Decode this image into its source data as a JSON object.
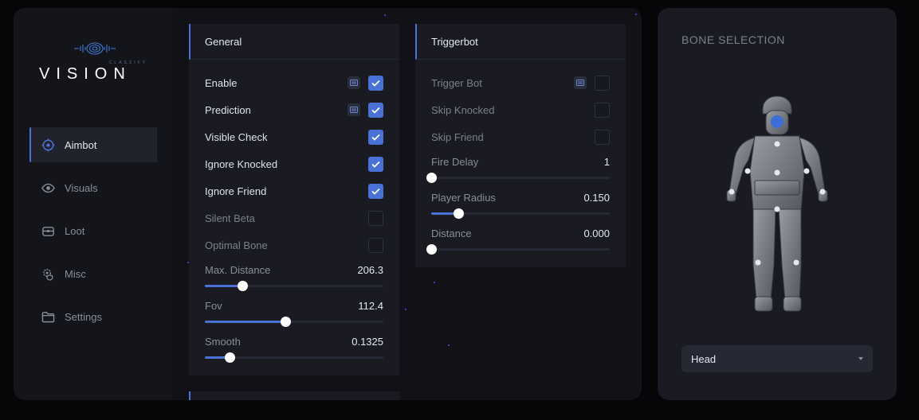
{
  "logo": {
    "tagline": "CLASSIFY",
    "word": "VISION"
  },
  "nav": [
    {
      "label": "Aimbot",
      "icon": "target-icon",
      "active": true
    },
    {
      "label": "Visuals",
      "icon": "eye-icon",
      "active": false
    },
    {
      "label": "Loot",
      "icon": "chest-icon",
      "active": false
    },
    {
      "label": "Misc",
      "icon": "gear-shield-icon",
      "active": false
    },
    {
      "label": "Settings",
      "icon": "folder-icon",
      "active": false
    }
  ],
  "general": {
    "title": "General",
    "toggles": [
      {
        "label": "Enable",
        "checked": true,
        "keybind": true
      },
      {
        "label": "Prediction",
        "checked": true,
        "keybind": true
      },
      {
        "label": "Visible Check",
        "checked": true,
        "keybind": false
      },
      {
        "label": "Ignore Knocked",
        "checked": true,
        "keybind": false
      },
      {
        "label": "Ignore Friend",
        "checked": true,
        "keybind": false
      },
      {
        "label": "Silent Beta",
        "checked": false,
        "keybind": false
      },
      {
        "label": "Optimal Bone",
        "checked": false,
        "keybind": false
      }
    ],
    "sliders": [
      {
        "label": "Max. Distance",
        "value": "206.3",
        "fraction": 0.21
      },
      {
        "label": "Fov",
        "value": "112.4",
        "fraction": 0.45
      },
      {
        "label": "Smooth",
        "value": "0.1325",
        "fraction": 0.14
      }
    ]
  },
  "triggerbot": {
    "title": "Triggerbot",
    "toggles": [
      {
        "label": "Trigger Bot",
        "checked": false,
        "keybind": true
      },
      {
        "label": "Skip Knocked",
        "checked": false,
        "keybind": false
      },
      {
        "label": "Skip Friend",
        "checked": false,
        "keybind": false
      }
    ],
    "sliders": [
      {
        "label": "Fire Delay",
        "value": "1",
        "fraction": 0.0
      },
      {
        "label": "Player Radius",
        "value": "0.150",
        "fraction": 0.15
      },
      {
        "label": "Distance",
        "value": "0.000",
        "fraction": 0.0
      }
    ]
  },
  "bone": {
    "title": "BONE SELECTION",
    "selected": "Head"
  },
  "colors": {
    "accent": "#4a72d6",
    "panel": "#1a1b22",
    "window": "#111218"
  }
}
